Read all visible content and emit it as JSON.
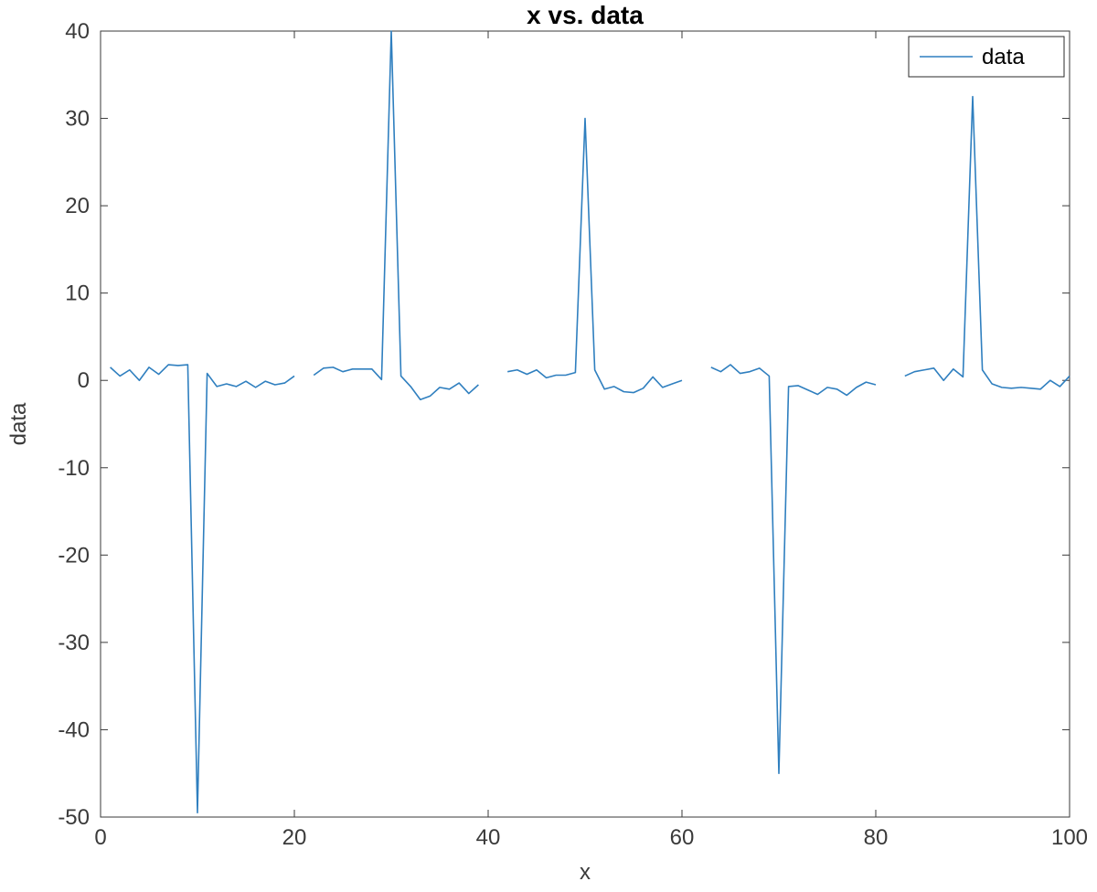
{
  "chart_data": {
    "type": "line",
    "title": "x vs. data",
    "xlabel": "x",
    "ylabel": "data",
    "xlim": [
      0,
      100
    ],
    "ylim": [
      -50,
      40
    ],
    "xticks": [
      0,
      20,
      40,
      60,
      80,
      100
    ],
    "yticks": [
      -50,
      -40,
      -30,
      -20,
      -10,
      0,
      10,
      20,
      30,
      40
    ],
    "legend": {
      "entries": [
        "data"
      ],
      "position": "upper right"
    },
    "series": [
      {
        "name": "data",
        "x": [
          1,
          2,
          3,
          4,
          5,
          6,
          7,
          8,
          9,
          10,
          11,
          12,
          13,
          14,
          15,
          16,
          17,
          18,
          19,
          20,
          21,
          22,
          23,
          24,
          25,
          26,
          27,
          28,
          29,
          30,
          31,
          32,
          33,
          34,
          35,
          36,
          37,
          38,
          39,
          40,
          41,
          42,
          43,
          44,
          45,
          46,
          47,
          48,
          49,
          50,
          51,
          52,
          53,
          54,
          55,
          56,
          57,
          58,
          59,
          60,
          61,
          62,
          63,
          64,
          65,
          66,
          67,
          68,
          69,
          70,
          71,
          72,
          73,
          74,
          75,
          76,
          77,
          78,
          79,
          80,
          81,
          82,
          83,
          84,
          85,
          86,
          87,
          88,
          89,
          90,
          91,
          92,
          93,
          94,
          95,
          96,
          97,
          98,
          99,
          100
        ],
        "values": [
          1.5,
          0.5,
          1.2,
          0.0,
          1.5,
          0.7,
          1.8,
          1.7,
          1.8,
          -49.5,
          0.8,
          -0.7,
          -0.4,
          -0.7,
          -0.1,
          -0.8,
          -0.1,
          -0.5,
          -0.3,
          0.5,
          null,
          0.6,
          1.4,
          1.5,
          1.0,
          1.3,
          1.3,
          1.3,
          0.1,
          40.0,
          0.5,
          -0.7,
          -2.2,
          -1.8,
          -0.8,
          -1.0,
          -0.3,
          -1.5,
          -0.5,
          null,
          null,
          1.0,
          1.2,
          0.7,
          1.2,
          0.3,
          0.6,
          0.6,
          0.9,
          30.0,
          1.2,
          -1.0,
          -0.7,
          -1.3,
          -1.4,
          -0.9,
          0.4,
          -0.8,
          -0.4,
          0.0,
          null,
          null,
          1.5,
          1.0,
          1.8,
          0.8,
          1.0,
          1.4,
          0.5,
          -45.0,
          -0.7,
          -0.6,
          -1.1,
          -1.6,
          -0.8,
          -1.0,
          -1.7,
          -0.8,
          -0.2,
          -0.5,
          null,
          null,
          0.5,
          1.0,
          1.2,
          1.4,
          0.0,
          1.3,
          0.4,
          32.5,
          1.2,
          -0.4,
          -0.8,
          -0.9,
          -0.8,
          -0.9,
          -1.0,
          0.0,
          -0.7,
          0.5
        ]
      }
    ]
  },
  "colors": {
    "line": "#2f7fbf",
    "axis": "#3a3a3a"
  }
}
